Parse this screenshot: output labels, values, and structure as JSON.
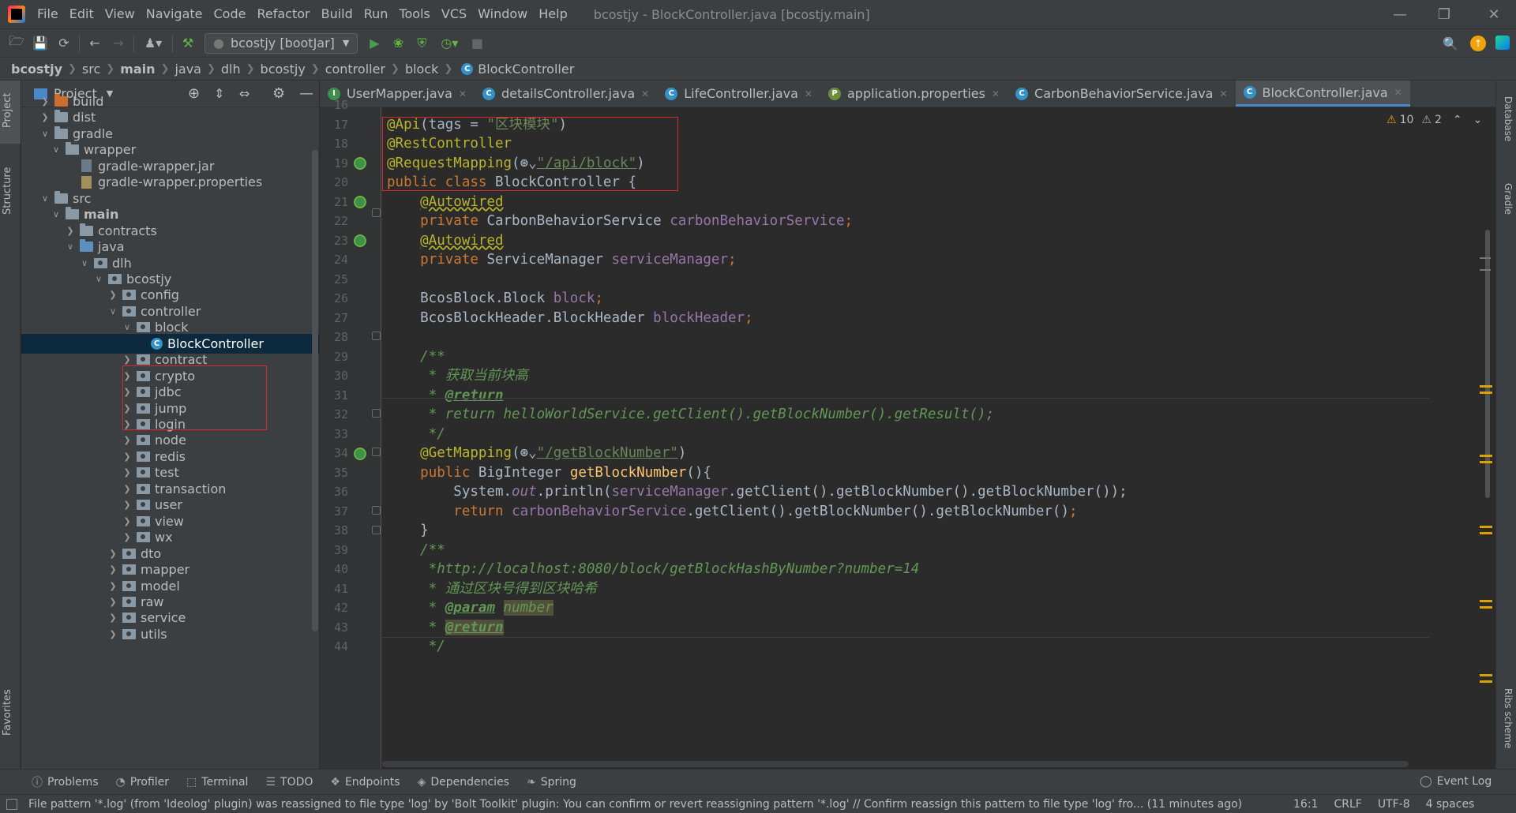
{
  "menu": [
    "File",
    "Edit",
    "View",
    "Navigate",
    "Code",
    "Refactor",
    "Build",
    "Run",
    "Tools",
    "VCS",
    "Window",
    "Help"
  ],
  "window_title": "bcostjy - BlockController.java [bcostjy.main]",
  "run_config": "bcostjy [bootJar]",
  "breadcrumbs": [
    "bcostjy",
    "src",
    "main",
    "java",
    "dlh",
    "bcostjy",
    "controller",
    "block",
    "BlockController"
  ],
  "project_panel": {
    "title": "Project"
  },
  "tree": [
    {
      "label": "build",
      "depth": 1,
      "kind": "folder-orange",
      "arrow": "right"
    },
    {
      "label": "dist",
      "depth": 1,
      "kind": "folder",
      "arrow": "right"
    },
    {
      "label": "gradle",
      "depth": 1,
      "kind": "folder",
      "arrow": "down"
    },
    {
      "label": "wrapper",
      "depth": 2,
      "kind": "folder",
      "arrow": "down"
    },
    {
      "label": "gradle-wrapper.jar",
      "depth": 3,
      "kind": "file",
      "arrow": ""
    },
    {
      "label": "gradle-wrapper.properties",
      "depth": 3,
      "kind": "file-prop",
      "arrow": ""
    },
    {
      "label": "src",
      "depth": 1,
      "kind": "folder",
      "arrow": "down"
    },
    {
      "label": "main",
      "depth": 2,
      "kind": "folder",
      "arrow": "down",
      "bold": true
    },
    {
      "label": "contracts",
      "depth": 3,
      "kind": "folder",
      "arrow": "right"
    },
    {
      "label": "java",
      "depth": 3,
      "kind": "folder-blue",
      "arrow": "down"
    },
    {
      "label": "dlh",
      "depth": 4,
      "kind": "pkg",
      "arrow": "down"
    },
    {
      "label": "bcostjy",
      "depth": 5,
      "kind": "pkg",
      "arrow": "down"
    },
    {
      "label": "config",
      "depth": 6,
      "kind": "pkg",
      "arrow": "right"
    },
    {
      "label": "controller",
      "depth": 6,
      "kind": "pkg",
      "arrow": "down"
    },
    {
      "label": "block",
      "depth": 7,
      "kind": "pkg",
      "arrow": "down"
    },
    {
      "label": "BlockController",
      "depth": 8,
      "kind": "class",
      "arrow": "",
      "selected": true
    },
    {
      "label": "contract",
      "depth": 7,
      "kind": "pkg",
      "arrow": "right"
    },
    {
      "label": "crypto",
      "depth": 7,
      "kind": "pkg",
      "arrow": "right"
    },
    {
      "label": "jdbc",
      "depth": 7,
      "kind": "pkg",
      "arrow": "right"
    },
    {
      "label": "jump",
      "depth": 7,
      "kind": "pkg",
      "arrow": "right"
    },
    {
      "label": "login",
      "depth": 7,
      "kind": "pkg",
      "arrow": "right"
    },
    {
      "label": "node",
      "depth": 7,
      "kind": "pkg",
      "arrow": "right"
    },
    {
      "label": "redis",
      "depth": 7,
      "kind": "pkg",
      "arrow": "right"
    },
    {
      "label": "test",
      "depth": 7,
      "kind": "pkg",
      "arrow": "right"
    },
    {
      "label": "transaction",
      "depth": 7,
      "kind": "pkg",
      "arrow": "right"
    },
    {
      "label": "user",
      "depth": 7,
      "kind": "pkg",
      "arrow": "right"
    },
    {
      "label": "view",
      "depth": 7,
      "kind": "pkg",
      "arrow": "right"
    },
    {
      "label": "wx",
      "depth": 7,
      "kind": "pkg",
      "arrow": "right"
    },
    {
      "label": "dto",
      "depth": 6,
      "kind": "pkg",
      "arrow": "right"
    },
    {
      "label": "mapper",
      "depth": 6,
      "kind": "pkg",
      "arrow": "right"
    },
    {
      "label": "model",
      "depth": 6,
      "kind": "pkg",
      "arrow": "right"
    },
    {
      "label": "raw",
      "depth": 6,
      "kind": "pkg",
      "arrow": "right"
    },
    {
      "label": "service",
      "depth": 6,
      "kind": "pkg",
      "arrow": "right"
    },
    {
      "label": "utils",
      "depth": 6,
      "kind": "pkg",
      "arrow": "right"
    }
  ],
  "tabs": [
    {
      "label": "UserMapper.java",
      "icon": "I",
      "color": "#3d8f4a",
      "active": false
    },
    {
      "label": "detailsController.java",
      "icon": "C",
      "color": "#3592c4",
      "active": false
    },
    {
      "label": "LifeController.java",
      "icon": "C",
      "color": "#3592c4",
      "active": false
    },
    {
      "label": "application.properties",
      "icon": "P",
      "color": "#6b8e3a",
      "active": false
    },
    {
      "label": "CarbonBehaviorService.java",
      "icon": "C",
      "color": "#3592c4",
      "active": false
    },
    {
      "label": "BlockController.java",
      "icon": "C",
      "color": "#3592c4",
      "active": true
    }
  ],
  "inspections": {
    "warnings": "10",
    "weak_warnings": "2"
  },
  "line_numbers": [
    "16",
    "17",
    "18",
    "19",
    "20",
    "21",
    "22",
    "23",
    "24",
    "25",
    "26",
    "27",
    "28",
    "29",
    "30",
    "31",
    "32",
    "33",
    "34",
    "35",
    "36",
    "37",
    "38",
    "39",
    "40",
    "41",
    "42",
    "43",
    "44"
  ],
  "code_lines": [
    [],
    [
      {
        "t": "@Api",
        "c": "ann"
      },
      {
        "t": "(tags = "
      },
      {
        "t": "\"区块模块\"",
        "c": "str"
      },
      {
        "t": ")"
      }
    ],
    [
      {
        "t": "@RestController",
        "c": "ann"
      }
    ],
    [
      {
        "t": "@RequestMapping",
        "c": "ann"
      },
      {
        "t": "(⊛⌄"
      },
      {
        "t": "\"/api/block\"",
        "c": "str u"
      },
      {
        "t": ")"
      }
    ],
    [
      {
        "t": "public class ",
        "c": "kw"
      },
      {
        "t": "BlockController {"
      }
    ],
    [
      {
        "t": "    "
      },
      {
        "t": "@Autowired",
        "c": "ann wavy"
      }
    ],
    [
      {
        "t": "    "
      },
      {
        "t": "private ",
        "c": "kw"
      },
      {
        "t": "CarbonBehaviorService "
      },
      {
        "t": "carbonBehaviorService",
        "c": "fld"
      },
      {
        "t": ";",
        "c": "kw"
      }
    ],
    [
      {
        "t": "    "
      },
      {
        "t": "@Autowired",
        "c": "ann wavy"
      }
    ],
    [
      {
        "t": "    "
      },
      {
        "t": "private ",
        "c": "kw"
      },
      {
        "t": "ServiceManager "
      },
      {
        "t": "serviceManager",
        "c": "fld"
      },
      {
        "t": ";",
        "c": "kw"
      }
    ],
    [],
    [
      {
        "t": "    BcosBlock.Block "
      },
      {
        "t": "block",
        "c": "fld"
      },
      {
        "t": ";",
        "c": "kw"
      }
    ],
    [
      {
        "t": "    BcosBlockHeader.BlockHeader "
      },
      {
        "t": "blockHeader",
        "c": "fld"
      },
      {
        "t": ";",
        "c": "kw"
      }
    ],
    [],
    [
      {
        "t": "    /**",
        "c": "com"
      }
    ],
    [
      {
        "t": "     * 获取当前块高",
        "c": "com"
      }
    ],
    [
      {
        "t": "     * ",
        "c": "com"
      },
      {
        "t": "@return",
        "c": "tag"
      }
    ],
    [
      {
        "t": "     * return helloWorldService.getClient().getBlockNumber().getResult();",
        "c": "com"
      }
    ],
    [
      {
        "t": "     */",
        "c": "com"
      }
    ],
    [
      {
        "t": "    "
      },
      {
        "t": "@GetMapping",
        "c": "ann"
      },
      {
        "t": "(⊛⌄"
      },
      {
        "t": "\"/getBlockNumber\"",
        "c": "str u"
      },
      {
        "t": ")"
      }
    ],
    [
      {
        "t": "    "
      },
      {
        "t": "public ",
        "c": "kw"
      },
      {
        "t": "BigInteger "
      },
      {
        "t": "getBlockNumber",
        "c": "meth"
      },
      {
        "t": "(){"
      }
    ],
    [
      {
        "t": "        System."
      },
      {
        "t": "out",
        "c": "stat"
      },
      {
        "t": ".println("
      },
      {
        "t": "serviceManager",
        "c": "fld"
      },
      {
        "t": ".getClient().getBlockNumber().getBlockNumber());"
      }
    ],
    [
      {
        "t": "        "
      },
      {
        "t": "return ",
        "c": "kw"
      },
      {
        "t": "carbonBehaviorService",
        "c": "fld"
      },
      {
        "t": ".getClient().getBlockNumber().getBlockNumber()"
      },
      {
        "t": ";",
        "c": "kw"
      }
    ],
    [
      {
        "t": "    }"
      }
    ],
    [
      {
        "t": "    /**",
        "c": "com"
      }
    ],
    [
      {
        "t": "     *http://localhost:8080/block/getBlockHashByNumber?number=14",
        "c": "com"
      }
    ],
    [
      {
        "t": "     * 通过区块号得到区块哈希",
        "c": "com"
      }
    ],
    [
      {
        "t": "     * ",
        "c": "com"
      },
      {
        "t": "@param",
        "c": "tag"
      },
      {
        "t": " "
      },
      {
        "t": "number",
        "c": "com hl"
      }
    ],
    [
      {
        "t": "     * ",
        "c": "com"
      },
      {
        "t": "@return",
        "c": "tag hl"
      }
    ],
    [
      {
        "t": "     */",
        "c": "com"
      }
    ]
  ],
  "tool_windows": [
    "Problems",
    "Profiler",
    "Terminal",
    "TODO",
    "Endpoints",
    "Dependencies",
    "Spring"
  ],
  "event_log": "Event Log",
  "side_labels": {
    "project": "Project",
    "structure": "Structure",
    "favorites": "Favorites",
    "database": "Database",
    "gradle": "Gradle",
    "ribs": "Ribs scheme"
  },
  "status": {
    "message": "File pattern '*.log' (from 'Ideolog' plugin) was reassigned to file type 'log' by 'Bolt Toolkit' plugin: You can confirm or revert reassigning pattern '*.log' // Confirm reassign this pattern to file type 'log' fro... (11 minutes ago)",
    "position": "16:1",
    "line_sep": "CRLF",
    "encoding": "UTF-8",
    "indent": "4 spaces"
  }
}
